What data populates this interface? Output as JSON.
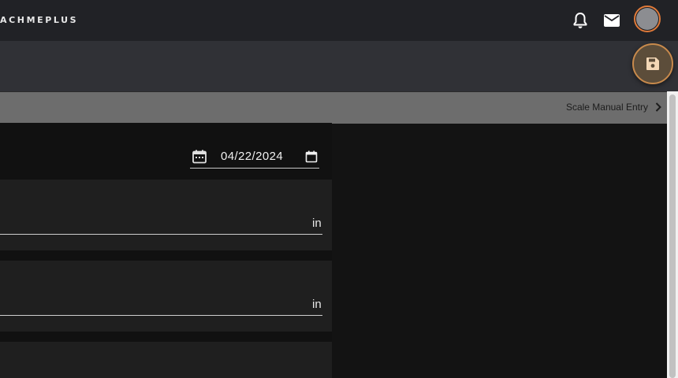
{
  "header": {
    "brand": "ACHMEPLUS",
    "icons": [
      "bell-icon",
      "mail-icon"
    ],
    "accent_color": "#e07a3a"
  },
  "actions": {
    "save_icon": "save-icon"
  },
  "breadcrumb": {
    "label": "Scale Manual Entry"
  },
  "form": {
    "date_value": "04/22/2024",
    "fields": [
      {
        "unit": "in"
      },
      {
        "unit": "in"
      }
    ]
  }
}
